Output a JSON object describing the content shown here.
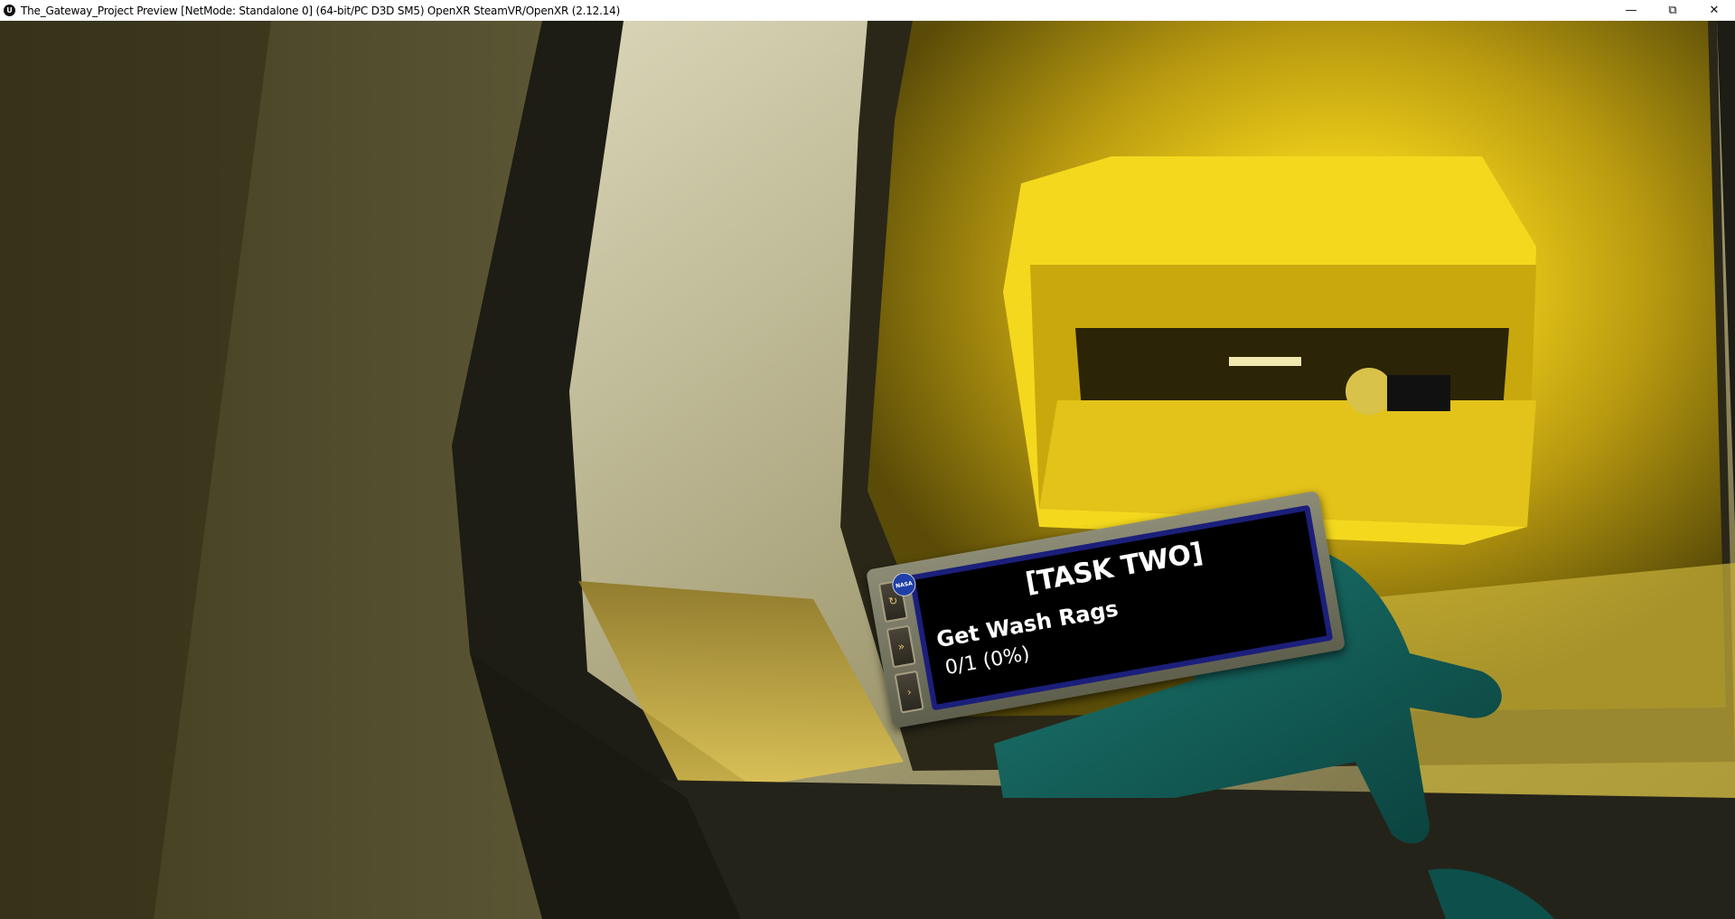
{
  "window": {
    "logo_glyph": "U",
    "title": "The_Gateway_Project Preview [NetMode: Standalone 0]  (64-bit/PC D3D SM5) OpenXR SteamVR/OpenXR (2.12.14)",
    "minimize_glyph": "—",
    "restore_glyph": "⧉",
    "close_glyph": "✕"
  },
  "wrist_tablet": {
    "badge_text": "NASA",
    "task_title": "[TASK TWO]",
    "task_name": "Get Wash Rags",
    "task_progress_text": "0/1 (0%)",
    "progress": {
      "completed": 0,
      "total": 1,
      "percent": 0
    },
    "side_buttons": [
      {
        "icon": "refresh-icon",
        "glyph": "↻"
      },
      {
        "icon": "fast-forward-icon",
        "glyph": "»"
      },
      {
        "icon": "play-icon",
        "glyph": "›"
      }
    ]
  },
  "colors": {
    "corridor_glow": "#f2d21a",
    "screen_border": "#1b1f7a",
    "glove": "#0f5a55"
  }
}
